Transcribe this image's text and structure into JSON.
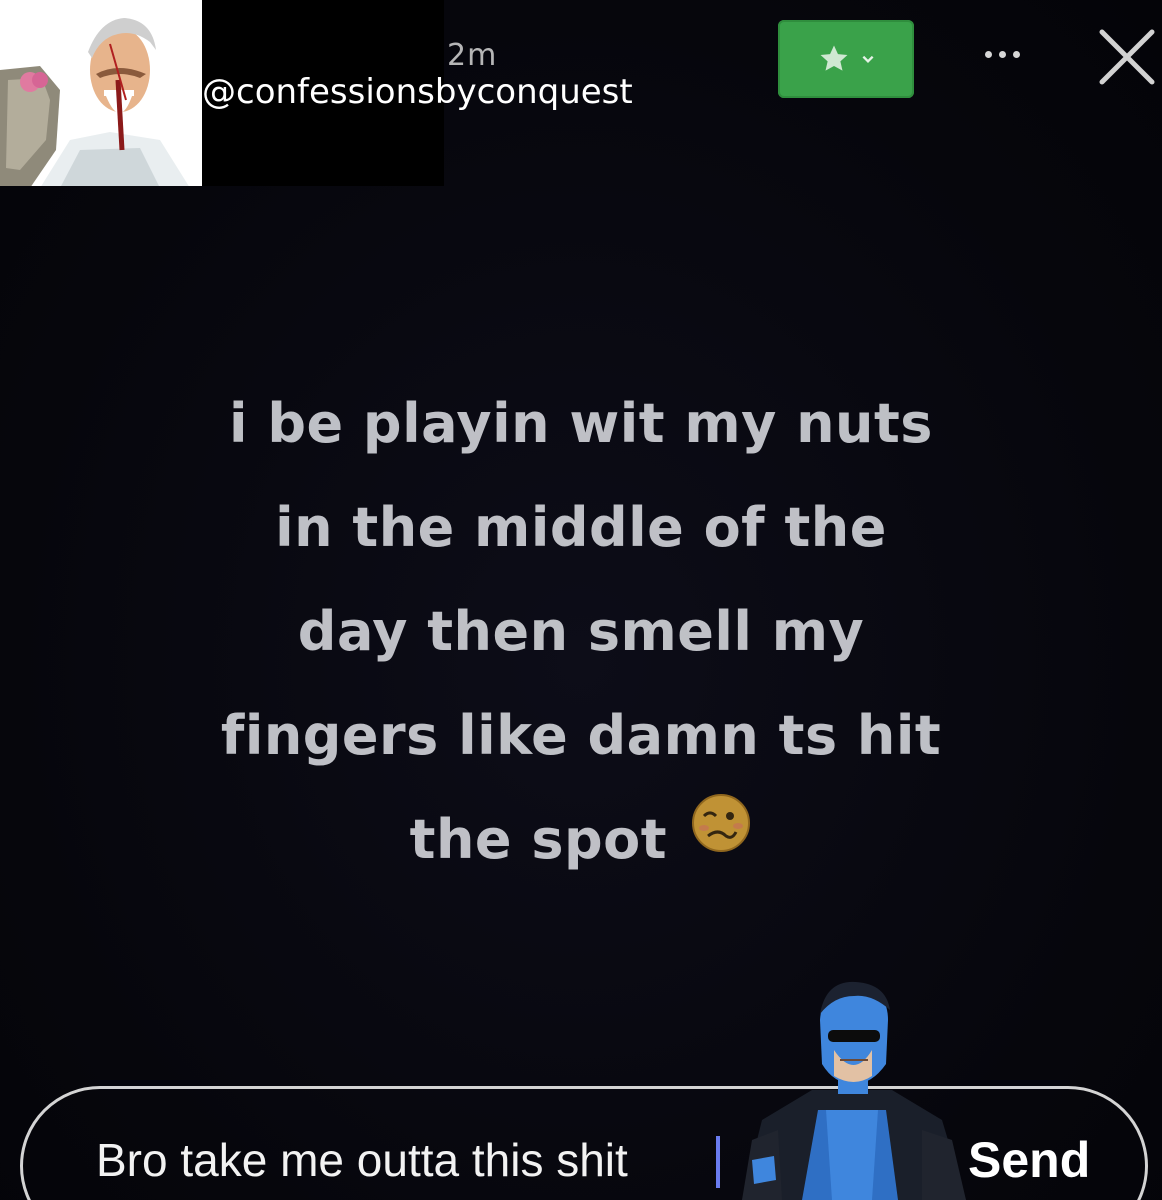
{
  "header": {
    "handle": "@confessionsbyconquest",
    "timestamp": "2m"
  },
  "toolbar": {
    "star_icon": "star-icon",
    "chevron_icon": "chevron-down-icon",
    "more_icon": "more-dots-icon",
    "close_icon": "close-icon",
    "accent_color": "#3aa24a"
  },
  "message": {
    "lines": [
      "i be playin wit my nuts",
      "in the middle of the",
      "day then smell my",
      "fingers like damn ts hit",
      "the spot"
    ],
    "emoji": "woozy-face-icon"
  },
  "composer": {
    "value": "Bro take me outta this shit",
    "send_label": "Send"
  }
}
